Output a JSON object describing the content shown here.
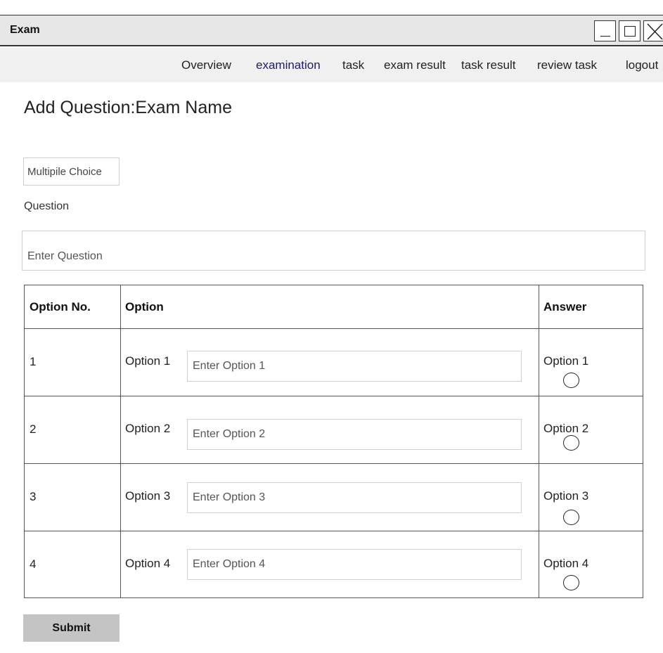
{
  "window": {
    "title": "Exam"
  },
  "nav": {
    "items": [
      "Overview",
      "examination",
      "task",
      "exam result",
      "task result",
      "review task",
      "logout"
    ],
    "active": "examination",
    "active_color": "#1c1c6e"
  },
  "page": {
    "title": "Add Question:Exam Name"
  },
  "form": {
    "question_type": "Multipile Choice",
    "question_label": "Question",
    "question_placeholder": "Enter Question"
  },
  "table": {
    "headers": [
      "Option No.",
      "Option",
      "Answer"
    ],
    "rows": [
      {
        "number": "1",
        "label": "Option 1",
        "placeholder": "Enter Option 1",
        "answer": "Option 1",
        "selected": false
      },
      {
        "number": "2",
        "label": "Option 2",
        "placeholder": "Enter Option 2",
        "answer": "Option 2",
        "selected": false
      },
      {
        "number": "3",
        "label": "Option 3",
        "placeholder": "Enter Option 3",
        "answer": "Option 3",
        "selected": false
      },
      {
        "number": "4",
        "label": "Option 4",
        "placeholder": "Enter Option 4",
        "answer": "Option 4",
        "selected": false
      }
    ]
  },
  "actions": {
    "submit_label": "Submit",
    "submit_color": "#c4c4c4"
  },
  "icons": {
    "minimize": "minimize-icon",
    "maximize": "maximize-icon",
    "close": "close-icon",
    "radio": "radio-unchecked-icon"
  }
}
